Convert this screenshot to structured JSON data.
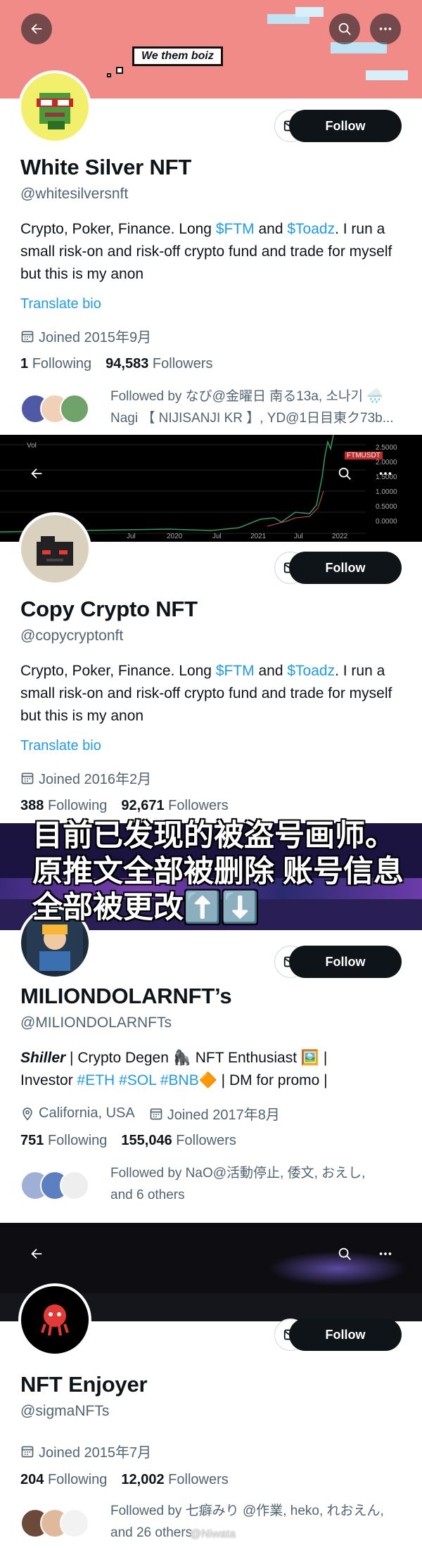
{
  "colors": {
    "link": "#1d9bf0",
    "follow_bg": "#0f1419",
    "muted": "#536471"
  },
  "icons": [
    "back-arrow-icon",
    "search-icon",
    "more-icon",
    "mail-icon",
    "calendar-icon",
    "location-icon"
  ],
  "overlay_caption": "目前已发现的被盗号画师。原推文全部被删除 账号信息全部被更改⬆️⬇️",
  "watermark": "@Niwata",
  "profiles": [
    {
      "banner_badge": "We them boiz",
      "name": "White Silver NFT",
      "handle": "@whitesilversnft",
      "bio_before": "Crypto, Poker, Finance. Long ",
      "bio_link1": "$FTM",
      "bio_mid": " and ",
      "bio_link2": "$Toadz",
      "bio_after": ". I run a small risk-on and risk-off crypto fund and trade for myself but this is my anon",
      "translate": "Translate bio",
      "joined": "Joined 2015年9月",
      "following_count": "1",
      "following_label": "Following",
      "followers_count": "94,583",
      "followers_label": "Followers",
      "followed_by_line1": "Followed by なび@金曜日 南る13a, 소나기 🌧️",
      "followed_by_line2": "Nagi 【 NIJISANJI KR 】, YD@1日目東ク73b..."
    },
    {
      "chart_ticks_y": [
        "2.5000",
        "2.0000",
        "1.5000",
        "1.0000",
        "0.5000",
        "0.0000"
      ],
      "chart_ticks_x": [
        "Jul",
        "2020",
        "Jul",
        "2021",
        "Jul",
        "2022"
      ],
      "chart_vol": "Vol",
      "chart_price_tag": "FTMUSDT",
      "name": "Copy Crypto NFT",
      "handle": "@copycryptonft",
      "bio_before": "Crypto, Poker, Finance. Long ",
      "bio_link1": "$FTM",
      "bio_mid": " and ",
      "bio_link2": "$Toadz",
      "bio_after": ". I run a small risk-on and risk-off crypto fund and trade for myself but this is my anon",
      "translate": "Translate bio",
      "joined": "Joined 2016年2月",
      "following_count": "388",
      "following_label": "Following",
      "followers_count": "92,671",
      "followers_label": "Followers"
    },
    {
      "name": "MILIONDOLARNFT’s",
      "handle": "@MILIONDOLARNFTs",
      "bio_shiller": "Shiller",
      "bio_part1": " | Crypto Degen 🦍 NFT Enthusiast 🖼️ |",
      "bio_part2": "Investor ",
      "bio_tag1": "#ETH",
      "bio_tag2": "#SOL",
      "bio_tag3": "#BNB",
      "bio_part3": "🔶 | DM for promo |",
      "location": "California, USA",
      "joined": "Joined 2017年8月",
      "following_count": "751",
      "following_label": "Following",
      "followers_count": "155,046",
      "followers_label": "Followers",
      "followed_by_line1": "Followed by NaO@活動停止, 倭文, おえし,",
      "followed_by_line2": "and 6 others"
    },
    {
      "name": "NFT Enjoyer",
      "handle": "@sigmaNFTs",
      "joined": "Joined 2015年7月",
      "following_count": "204",
      "following_label": "Following",
      "followers_count": "12,002",
      "followers_label": "Followers",
      "followed_by_line1": "Followed by 七癖みり @作業, heko, れおえん,",
      "followed_by_line2": "and 26 others"
    }
  ]
}
